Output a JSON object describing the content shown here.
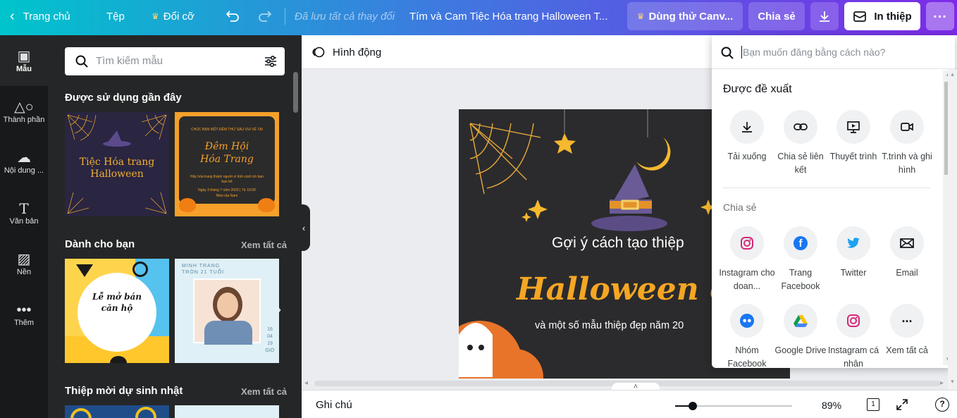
{
  "topbar": {
    "home": "Trang chủ",
    "file": "Tệp",
    "resize": "Đổi cỡ",
    "saved": "Đã lưu tất cả thay đổi",
    "doc_title": "Tím và Cam Tiệc Hóa trang Halloween T...",
    "try_canva": "Dùng thử Canv...",
    "share": "Chia sẻ",
    "print": "In thiệp"
  },
  "rail": {
    "items": [
      {
        "label": "Mẫu",
        "icon": "layout-icon"
      },
      {
        "label": "Thành phần",
        "icon": "shapes-icon"
      },
      {
        "label": "Nội dung ...",
        "icon": "upload-cloud-icon"
      },
      {
        "label": "Văn bản",
        "icon": "text-icon"
      },
      {
        "label": "Nền",
        "icon": "background-pattern-icon"
      },
      {
        "label": "Thêm",
        "icon": "more-dots-icon"
      }
    ]
  },
  "panel": {
    "search_placeholder": "Tìm kiếm mẫu",
    "recent_title": "Được sử dụng gần đây",
    "for_you_title": "Dành cho bạn",
    "for_you_see_all": "Xem tất cả",
    "birthday_title": "Thiệp mời dự sinh nhật",
    "birthday_see_all": "Xem tất cả",
    "thumb1": {
      "line1": "Tiệc Hóa trang",
      "line2": "Halloween"
    },
    "thumb2": {
      "top": "CHÚC BẠN MỘT ĐÊM THỨ SÁU VUI VẺ TẠI",
      "line1": "Đêm Hội",
      "line2": "Hóa Trang",
      "body": "Hãy hóa trang thành người vì tính cách trò ban bạn bề",
      "date": "Ngày 3 tháng 7 năm 2020 | Từ 19:00",
      "place": "Nhà của Nam"
    },
    "thumb3": {
      "line1": "Lễ mở bán",
      "line2": "căn hộ"
    },
    "thumb4": {
      "top": "MINH TRANG",
      "sub": "TRÒN 21 TUỔI",
      "side": [
        "16",
        "04",
        "19",
        "GIỜ"
      ]
    }
  },
  "toolbar": {
    "animate": "Hình động"
  },
  "design": {
    "line1": "Gợi ý cách tạo thiệp",
    "line2": "Halloween onli",
    "line3": "và một số mẫu thiệp đẹp năm 20"
  },
  "share_menu": {
    "search_placeholder": "Bạn muốn đăng bằng cách nào?",
    "suggested_title": "Được đề xuất",
    "suggested": [
      {
        "label": "Tải xuống",
        "icon": "download-icon"
      },
      {
        "label": "Chia sẻ liên kết",
        "icon": "link-icon"
      },
      {
        "label": "Thuyết trình",
        "icon": "present-icon"
      },
      {
        "label": "T.trình và ghi hình",
        "icon": "record-icon"
      }
    ],
    "share_title": "Chia sẻ",
    "share": [
      {
        "label": "Instagram cho doan...",
        "icon": "instagram-icon"
      },
      {
        "label": "Trang Facebook",
        "icon": "facebook-icon"
      },
      {
        "label": "Twitter",
        "icon": "twitter-icon"
      },
      {
        "label": "Email",
        "icon": "email-icon"
      },
      {
        "label": "Nhóm Facebook",
        "icon": "facebook-group-icon"
      },
      {
        "label": "Google Drive",
        "icon": "google-drive-icon"
      },
      {
        "label": "Instagram cá nhân",
        "icon": "instagram-icon"
      },
      {
        "label": "Xem tất cả",
        "icon": "more-icon"
      }
    ]
  },
  "bottombar": {
    "notes": "Ghi chú",
    "zoom": "89%",
    "page": "1",
    "zoom_level": 0.89
  },
  "colors": {
    "accent": "#7d2ae8",
    "orange": "#f5a623",
    "panel": "#252627",
    "rail": "#18191b"
  }
}
